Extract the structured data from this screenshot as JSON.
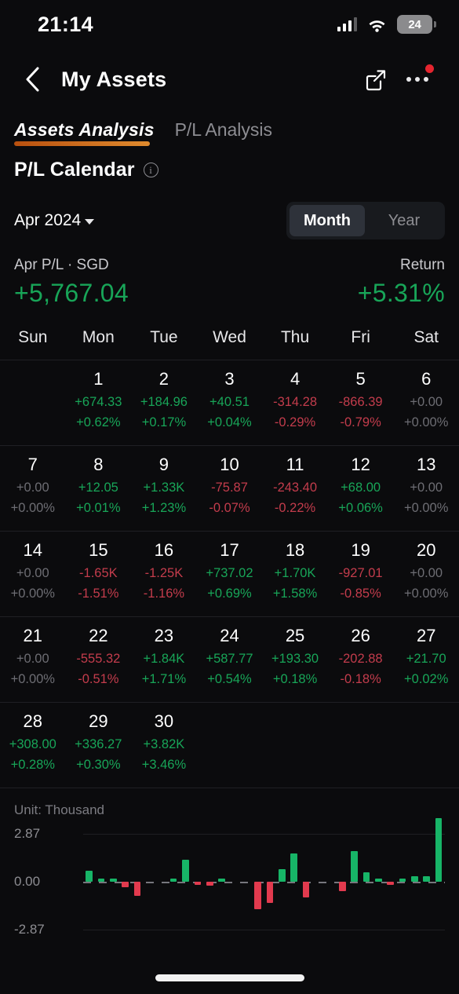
{
  "status_bar": {
    "time": "21:14",
    "battery_level": "24",
    "signal_icon": "cellular-signal-icon",
    "wifi_icon": "wifi-icon",
    "battery_icon": "battery-icon"
  },
  "header": {
    "back_icon": "chevron-left-icon",
    "title": "My Assets",
    "share_icon": "external-link-icon",
    "more_icon": "more-options-icon",
    "has_notification_dot": true
  },
  "tabs": [
    {
      "label": "Assets Analysis",
      "active": true
    },
    {
      "label": "P/L Analysis",
      "active": false
    }
  ],
  "section": {
    "title": "P/L Calendar",
    "info_icon": "info-circle-icon"
  },
  "controls": {
    "month_label": "Apr 2024",
    "dropdown_icon": "chevron-down-icon",
    "segments": [
      {
        "label": "Month",
        "active": true
      },
      {
        "label": "Year",
        "active": false
      }
    ]
  },
  "summary": {
    "pl_label": "Apr P/L · SGD",
    "pl_value": "+5,767.04",
    "return_label": "Return",
    "return_value": "+5.31%"
  },
  "colors": {
    "positive": "#18a558",
    "negative": "#c33c4c",
    "neutral": "#6d6d73",
    "accent": "#e08b2e",
    "background": "#0b0b0d"
  },
  "calendar": {
    "day_headers": [
      "Sun",
      "Mon",
      "Tue",
      "Wed",
      "Thu",
      "Fri",
      "Sat"
    ],
    "leading_blanks": 1,
    "days": [
      {
        "day": "1",
        "pl": "+674.33",
        "pct": "+0.62%",
        "sign": "pos"
      },
      {
        "day": "2",
        "pl": "+184.96",
        "pct": "+0.17%",
        "sign": "pos"
      },
      {
        "day": "3",
        "pl": "+40.51",
        "pct": "+0.04%",
        "sign": "pos"
      },
      {
        "day": "4",
        "pl": "-314.28",
        "pct": "-0.29%",
        "sign": "neg"
      },
      {
        "day": "5",
        "pl": "-866.39",
        "pct": "-0.79%",
        "sign": "neg"
      },
      {
        "day": "6",
        "pl": "+0.00",
        "pct": "+0.00%",
        "sign": "zero"
      },
      {
        "day": "7",
        "pl": "+0.00",
        "pct": "+0.00%",
        "sign": "zero"
      },
      {
        "day": "8",
        "pl": "+12.05",
        "pct": "+0.01%",
        "sign": "pos"
      },
      {
        "day": "9",
        "pl": "+1.33K",
        "pct": "+1.23%",
        "sign": "pos"
      },
      {
        "day": "10",
        "pl": "-75.87",
        "pct": "-0.07%",
        "sign": "neg"
      },
      {
        "day": "11",
        "pl": "-243.40",
        "pct": "-0.22%",
        "sign": "neg"
      },
      {
        "day": "12",
        "pl": "+68.00",
        "pct": "+0.06%",
        "sign": "pos"
      },
      {
        "day": "13",
        "pl": "+0.00",
        "pct": "+0.00%",
        "sign": "zero"
      },
      {
        "day": "14",
        "pl": "+0.00",
        "pct": "+0.00%",
        "sign": "zero"
      },
      {
        "day": "15",
        "pl": "-1.65K",
        "pct": "-1.51%",
        "sign": "neg"
      },
      {
        "day": "16",
        "pl": "-1.25K",
        "pct": "-1.16%",
        "sign": "neg"
      },
      {
        "day": "17",
        "pl": "+737.02",
        "pct": "+0.69%",
        "sign": "pos"
      },
      {
        "day": "18",
        "pl": "+1.70K",
        "pct": "+1.58%",
        "sign": "pos"
      },
      {
        "day": "19",
        "pl": "-927.01",
        "pct": "-0.85%",
        "sign": "neg"
      },
      {
        "day": "20",
        "pl": "+0.00",
        "pct": "+0.00%",
        "sign": "zero"
      },
      {
        "day": "21",
        "pl": "+0.00",
        "pct": "+0.00%",
        "sign": "zero"
      },
      {
        "day": "22",
        "pl": "-555.32",
        "pct": "-0.51%",
        "sign": "neg"
      },
      {
        "day": "23",
        "pl": "+1.84K",
        "pct": "+1.71%",
        "sign": "pos"
      },
      {
        "day": "24",
        "pl": "+587.77",
        "pct": "+0.54%",
        "sign": "pos"
      },
      {
        "day": "25",
        "pl": "+193.30",
        "pct": "+0.18%",
        "sign": "pos"
      },
      {
        "day": "26",
        "pl": "-202.88",
        "pct": "-0.18%",
        "sign": "neg"
      },
      {
        "day": "27",
        "pl": "+21.70",
        "pct": "+0.02%",
        "sign": "pos"
      },
      {
        "day": "28",
        "pl": "+308.00",
        "pct": "+0.28%",
        "sign": "pos"
      },
      {
        "day": "29",
        "pl": "+336.27",
        "pct": "+0.30%",
        "sign": "pos"
      },
      {
        "day": "30",
        "pl": "+3.82K",
        "pct": "+3.46%",
        "sign": "pos"
      }
    ]
  },
  "chart_data": {
    "type": "bar",
    "title": "",
    "unit_label": "Unit: Thousand",
    "xlabel": "",
    "ylabel": "",
    "ylim": [
      -2.87,
      2.87
    ],
    "yticks": [
      "2.87",
      "0.00",
      "-2.87"
    ],
    "grid": true,
    "legend": "none",
    "zero_line": "dashed",
    "categories": [
      "1",
      "2",
      "3",
      "4",
      "5",
      "6",
      "7",
      "8",
      "9",
      "10",
      "11",
      "12",
      "13",
      "14",
      "15",
      "16",
      "17",
      "18",
      "19",
      "20",
      "21",
      "22",
      "23",
      "24",
      "25",
      "26",
      "27",
      "28",
      "29",
      "30"
    ],
    "values": [
      0.674,
      0.185,
      0.041,
      -0.314,
      -0.866,
      0.0,
      0.0,
      0.012,
      1.33,
      -0.076,
      -0.243,
      0.068,
      0.0,
      0.0,
      -1.65,
      -1.25,
      0.737,
      1.7,
      -0.927,
      0.0,
      0.0,
      -0.555,
      1.84,
      0.588,
      0.193,
      -0.203,
      0.022,
      0.308,
      0.336,
      3.82
    ],
    "colors": {
      "positive": "#17b567",
      "negative": "#e23a4e"
    }
  }
}
